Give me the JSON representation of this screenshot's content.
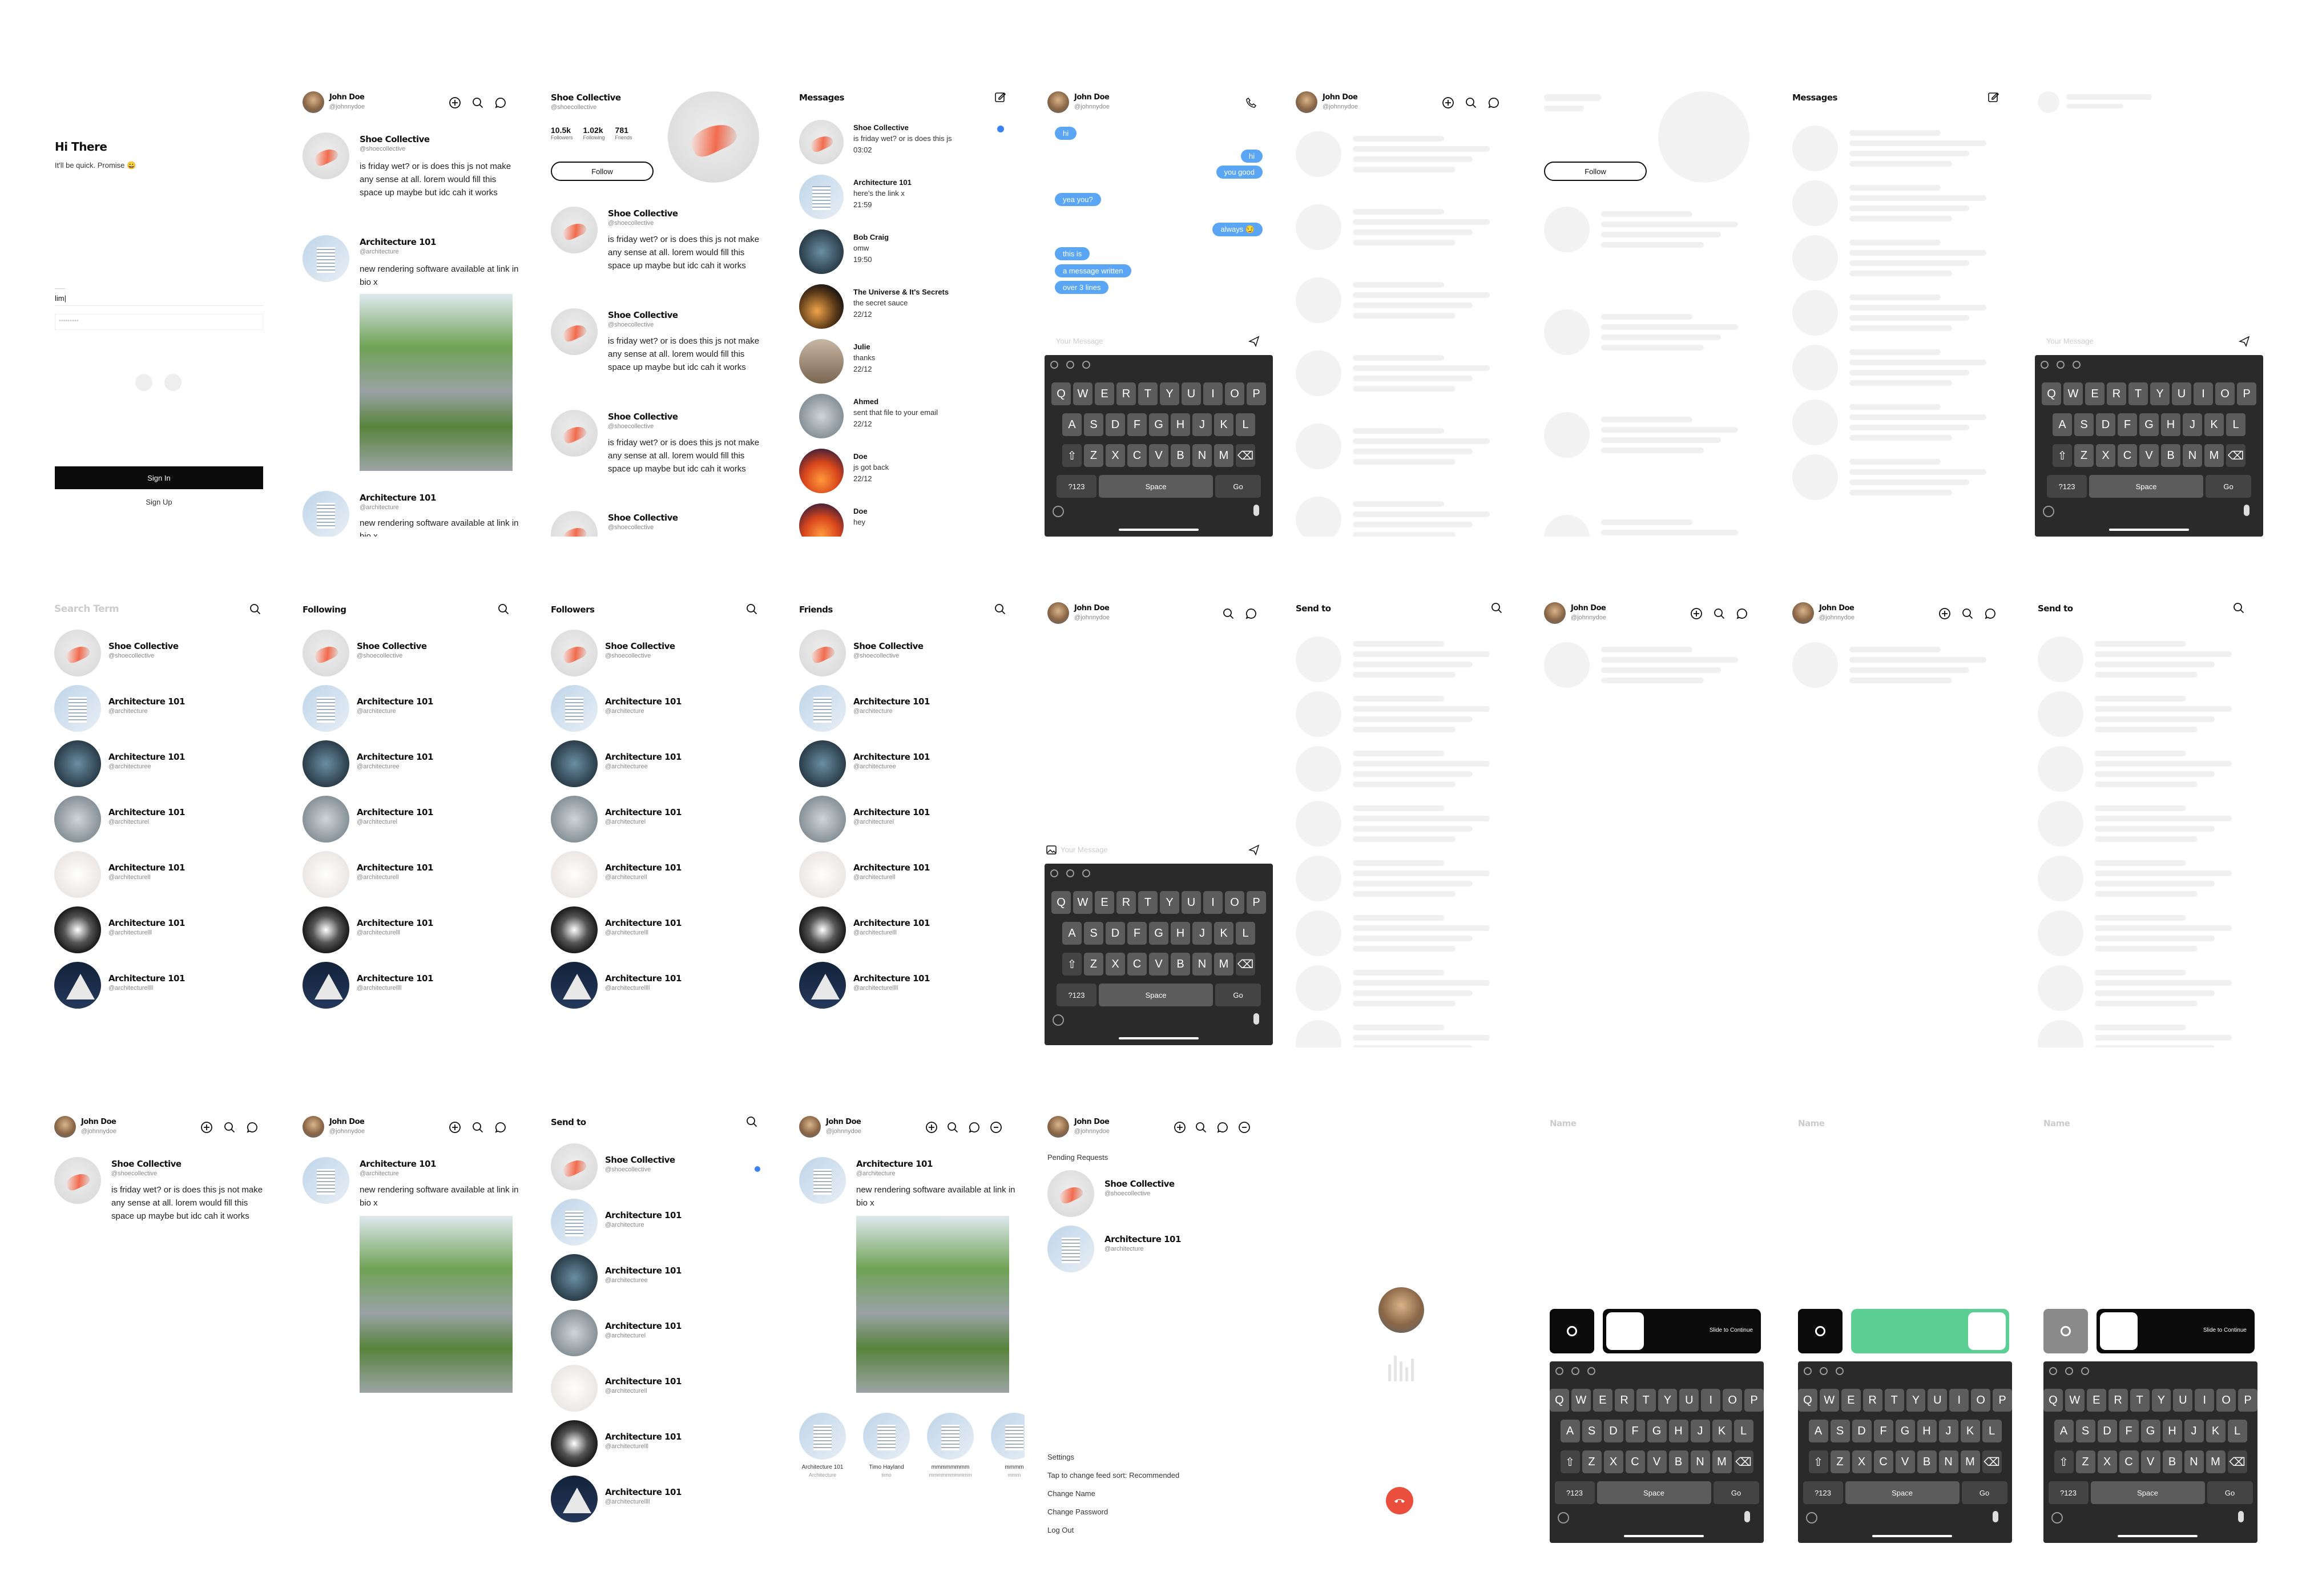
{
  "signin": {
    "greeting": "Hi There",
    "subtitle": "It'll be quick. Promise 😀",
    "field_label": "——",
    "username_value": "lim|",
    "password_mask": "•••••••••",
    "signin_label": "Sign In",
    "signup_label": "Sign Up"
  },
  "user": {
    "name": "John Doe",
    "handle": "@johnnydoe"
  },
  "post": {
    "shoe_name": "Shoe Collective",
    "shoe_handle": "@shoecollective",
    "shoe_text": "is friday wet? or is does this js not make any sense at all. lorem would fill this space up maybe but idc cah it works",
    "arch_name": "Architecture 101",
    "arch_handle": "@architecture",
    "arch_text": "new rendering software available at link in bio x"
  },
  "profile": {
    "name": "Shoe Collective",
    "handle": "@shoecollective",
    "stats": [
      {
        "value": "10.5k",
        "label": "Followers"
      },
      {
        "value": "1.02k",
        "label": "Following"
      },
      {
        "value": "781",
        "label": "Friends"
      }
    ],
    "follow_label": "Follow"
  },
  "messages": {
    "title": "Messages",
    "threads": [
      {
        "name": "Shoe Collective",
        "preview": "is friday wet? or is does this js",
        "time": "03:02",
        "unread": true
      },
      {
        "name": "Architecture 101",
        "preview": "here's the link x",
        "time": "21:59"
      },
      {
        "name": "Bob Craig",
        "preview": "omw",
        "time": "19:50"
      },
      {
        "name": "The Universe & It's Secrets",
        "preview": "the secret sauce",
        "time": "22/12"
      },
      {
        "name": "Julie",
        "preview": "thanks",
        "time": "22/12"
      },
      {
        "name": "Ahmed",
        "preview": "sent that file to your email",
        "time": "22/12"
      },
      {
        "name": "Doe",
        "preview": "js got back",
        "time": "22/12"
      },
      {
        "name": "Doe",
        "preview": "hey",
        "time": ""
      }
    ]
  },
  "chat": {
    "bubbles": [
      {
        "side": "left",
        "text": "hi"
      },
      {
        "side": "right",
        "text": "hi"
      },
      {
        "side": "right",
        "text": "you good"
      },
      {
        "side": "left",
        "text": "yea you?"
      },
      {
        "side": "right",
        "text": "always 😏"
      },
      {
        "side": "left",
        "text": "this is"
      },
      {
        "side": "left",
        "text": "a message written"
      },
      {
        "side": "left",
        "text": "over 3 lines"
      }
    ],
    "placeholder": "Your Message"
  },
  "keyboard": {
    "row1": [
      "Q",
      "W",
      "E",
      "R",
      "T",
      "Y",
      "U",
      "I",
      "O",
      "P"
    ],
    "row2": [
      "A",
      "S",
      "D",
      "F",
      "G",
      "H",
      "J",
      "K",
      "L"
    ],
    "row3": [
      "Z",
      "X",
      "C",
      "V",
      "B",
      "N",
      "M"
    ],
    "num_label": "?123",
    "space_label": "Space",
    "go_label": "Go"
  },
  "lists": {
    "search_placeholder": "Search Term",
    "following_title": "Following",
    "followers_title": "Followers",
    "friends_title": "Friends",
    "send_to_title": "Send to",
    "items": [
      {
        "name": "Shoe Collective",
        "handle": "@shoecollective"
      },
      {
        "name": "Architecture 101",
        "handle": "@architecture"
      },
      {
        "name": "Architecture 101",
        "handle": "@architecturee"
      },
      {
        "name": "Architecture 101",
        "handle": "@architecturel"
      },
      {
        "name": "Architecture 101",
        "handle": "@architecturell"
      },
      {
        "name": "Architecture 101",
        "handle": "@architecturelll"
      },
      {
        "name": "Architecture 101",
        "handle": "@architecturellll"
      }
    ]
  },
  "stories": [
    {
      "name": "Architecture 101",
      "sub": "Architecture"
    },
    {
      "name": "Timo Hayland",
      "sub": "timo"
    },
    {
      "name": "mmmmmmmm",
      "sub": "mmmmmmmmmm"
    },
    {
      "name": "mmmm",
      "sub": "mmm"
    }
  ],
  "settings": {
    "pending_title": "Pending Requests",
    "section_title": "Settings",
    "items": [
      "Tap to change feed sort: Recommended",
      "Change Name",
      "Change Password",
      "Log Out"
    ]
  },
  "name_screens": {
    "placeholder": "Name",
    "slide_label": "Slide to Continue"
  },
  "colors": {
    "accent": "#5aa6f5",
    "unread": "#3b82f6",
    "green": "#5ccf94",
    "call_red": "#e94f3c"
  }
}
